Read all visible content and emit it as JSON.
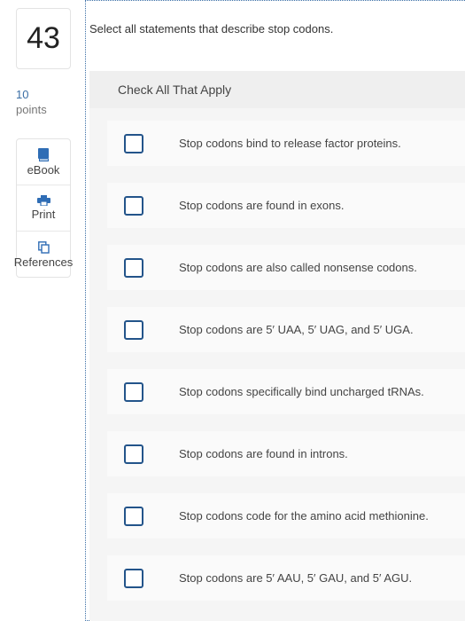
{
  "question": {
    "number": "43",
    "points_value": "10",
    "points_label": "points",
    "prompt": "Select all statements that describe stop codons.",
    "instruction": "Check All That Apply"
  },
  "tools": [
    {
      "label": "eBook",
      "icon": "book-icon"
    },
    {
      "label": "Print",
      "icon": "printer-icon"
    },
    {
      "label": "References",
      "icon": "copy-pages-icon"
    }
  ],
  "options": [
    {
      "text": "Stop codons bind to release factor proteins.",
      "checked": false
    },
    {
      "text": "Stop codons are found in exons.",
      "checked": false
    },
    {
      "text": "Stop codons are also called nonsense codons.",
      "checked": false
    },
    {
      "text": "Stop codons are 5′ UAA, 5′ UAG, and 5′ UGA.",
      "checked": false
    },
    {
      "text": "Stop codons specifically bind uncharged tRNAs.",
      "checked": false
    },
    {
      "text": "Stop codons are found in introns.",
      "checked": false
    },
    {
      "text": "Stop codons code for the amino acid methionine.",
      "checked": false
    },
    {
      "text": "Stop codons are 5′ AAU, 5′ GAU, and 5′ AGU.",
      "checked": false
    }
  ],
  "colors": {
    "accent": "#3a6ea5",
    "checkbox_border": "#23548a",
    "icon_blue": "#2f6db5"
  }
}
